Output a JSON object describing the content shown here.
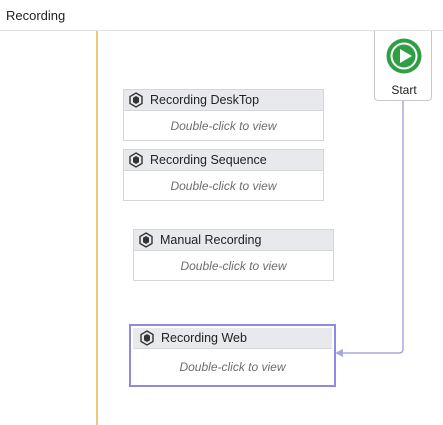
{
  "window": {
    "title": "Recording"
  },
  "start": {
    "label": "Start"
  },
  "activities": [
    {
      "name": "Recording DeskTop",
      "hint": "Double-click to view"
    },
    {
      "name": "Recording Sequence",
      "hint": "Double-click to view"
    },
    {
      "name": "Manual Recording",
      "hint": "Double-click to view"
    },
    {
      "name": "Recording Web",
      "hint": "Double-click to view"
    }
  ],
  "colors": {
    "start_green": "#2f9e44",
    "selection_border": "#8b8be6",
    "lifeline": "#f0c879",
    "connector": "#a7a7de"
  },
  "icons": {
    "start": "play-circle-icon",
    "activity": "workflow-activity-icon"
  }
}
